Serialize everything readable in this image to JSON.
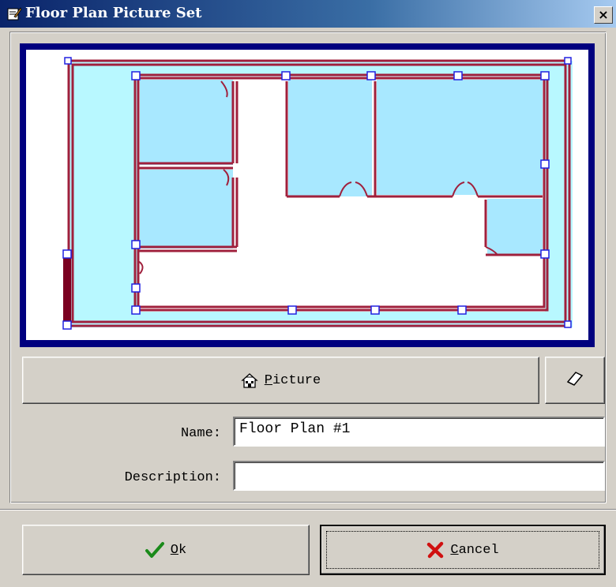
{
  "window": {
    "title": "Floor Plan Picture Set",
    "close_glyph": "×"
  },
  "preview": {
    "frame_color": "#00007f",
    "wall_color": "#a0203c",
    "room_fill": "#a8e8ff",
    "outer_fill": "#b8f8ff",
    "handle_color": "#2020e0"
  },
  "toolbar": {
    "picture_label_mnemonic": "P",
    "picture_label_rest": "icture",
    "picture_icon": "house-icon",
    "eraser_icon": "eraser-icon"
  },
  "form": {
    "name_label": "Name:",
    "name_value": "Floor Plan #1",
    "description_label": "Description:",
    "description_value": ""
  },
  "footer": {
    "ok_mnemonic": "O",
    "ok_rest": "k",
    "ok_icon": "checkmark-icon",
    "cancel_mnemonic": "C",
    "cancel_rest": "ancel",
    "cancel_icon": "x-icon"
  }
}
